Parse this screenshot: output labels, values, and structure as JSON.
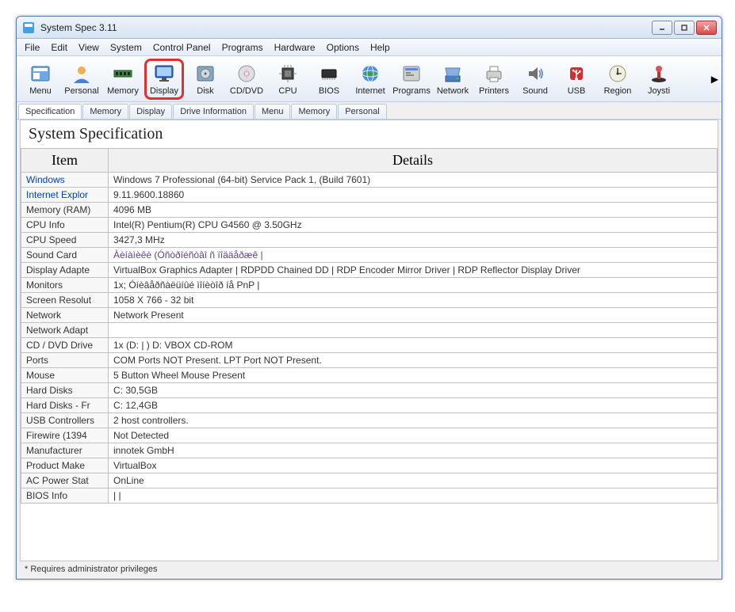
{
  "window": {
    "title": "System Spec 3.11"
  },
  "menubar": [
    "File",
    "Edit",
    "View",
    "System",
    "Control Panel",
    "Programs",
    "Hardware",
    "Options",
    "Help"
  ],
  "toolbar": [
    {
      "id": "menu",
      "label": "Menu"
    },
    {
      "id": "personal",
      "label": "Personal"
    },
    {
      "id": "memory",
      "label": "Memory"
    },
    {
      "id": "display",
      "label": "Display",
      "highlighted": true
    },
    {
      "id": "disk",
      "label": "Disk"
    },
    {
      "id": "cddvd",
      "label": "CD/DVD"
    },
    {
      "id": "cpu",
      "label": "CPU"
    },
    {
      "id": "bios",
      "label": "BIOS"
    },
    {
      "id": "internet",
      "label": "Internet"
    },
    {
      "id": "programs",
      "label": "Programs"
    },
    {
      "id": "network",
      "label": "Network"
    },
    {
      "id": "printers",
      "label": "Printers"
    },
    {
      "id": "sound",
      "label": "Sound"
    },
    {
      "id": "usb",
      "label": "USB"
    },
    {
      "id": "region",
      "label": "Region"
    },
    {
      "id": "joystick",
      "label": "Joysti"
    }
  ],
  "tabs": [
    "Specification",
    "Memory",
    "Display",
    "Drive Information",
    "Menu",
    "Memory",
    "Personal"
  ],
  "section_title": "System Specification",
  "table_headers": {
    "col1": "Item",
    "col2": "Details"
  },
  "rows": [
    {
      "item": "Windows",
      "detail": "Windows 7 Professional (64-bit) Service Pack 1,  (Build 7601)"
    },
    {
      "item": "Internet Explor",
      "detail": "9.11.9600.18860"
    },
    {
      "item": "Memory (RAM)",
      "detail": "4096 MB"
    },
    {
      "item": "CPU Info",
      "detail": "Intel(R) Pentium(R) CPU G4560 @ 3.50GHz"
    },
    {
      "item": "CPU Speed",
      "detail": "3427,3 MHz"
    },
    {
      "item": "Sound Card",
      "detail": "Àèíàìèêè (Óñòðîéñòâî ñ ïîääåðæê |"
    },
    {
      "item": "Display Adapte",
      "detail": "VirtualBox Graphics Adapter | RDPDD Chained DD | RDP Encoder Mirror Driver | RDP Reflector Display Driver"
    },
    {
      "item": "Monitors",
      "detail": "1x; Óíèâåðñàëüíûé ìîíèòîð íå PnP |"
    },
    {
      "item": "Screen Resolut",
      "detail": "1058 X 766 - 32 bit"
    },
    {
      "item": "Network",
      "detail": "Network Present"
    },
    {
      "item": "Network Adapt",
      "detail": ""
    },
    {
      "item": "CD / DVD Drive",
      "detail": "1x (D: | ) D: VBOX    CD-ROM"
    },
    {
      "item": "Ports",
      "detail": "COM Ports NOT Present. LPT Port NOT Present."
    },
    {
      "item": "Mouse",
      "detail": "5 Button Wheel Mouse Present"
    },
    {
      "item": "Hard Disks",
      "detail": "C:  30,5GB"
    },
    {
      "item": "Hard Disks - Fr",
      "detail": "C:  12,4GB"
    },
    {
      "item": "USB Controllers",
      "detail": "2 host controllers."
    },
    {
      "item": "Firewire (1394",
      "detail": "Not Detected"
    },
    {
      "item": "Manufacturer",
      "detail": "innotek GmbH"
    },
    {
      "item": "Product Make",
      "detail": "VirtualBox"
    },
    {
      "item": "AC Power Stat",
      "detail": "OnLine"
    },
    {
      "item": "BIOS Info",
      "detail": " |  |"
    }
  ],
  "footer": "* Requires administrator privileges"
}
